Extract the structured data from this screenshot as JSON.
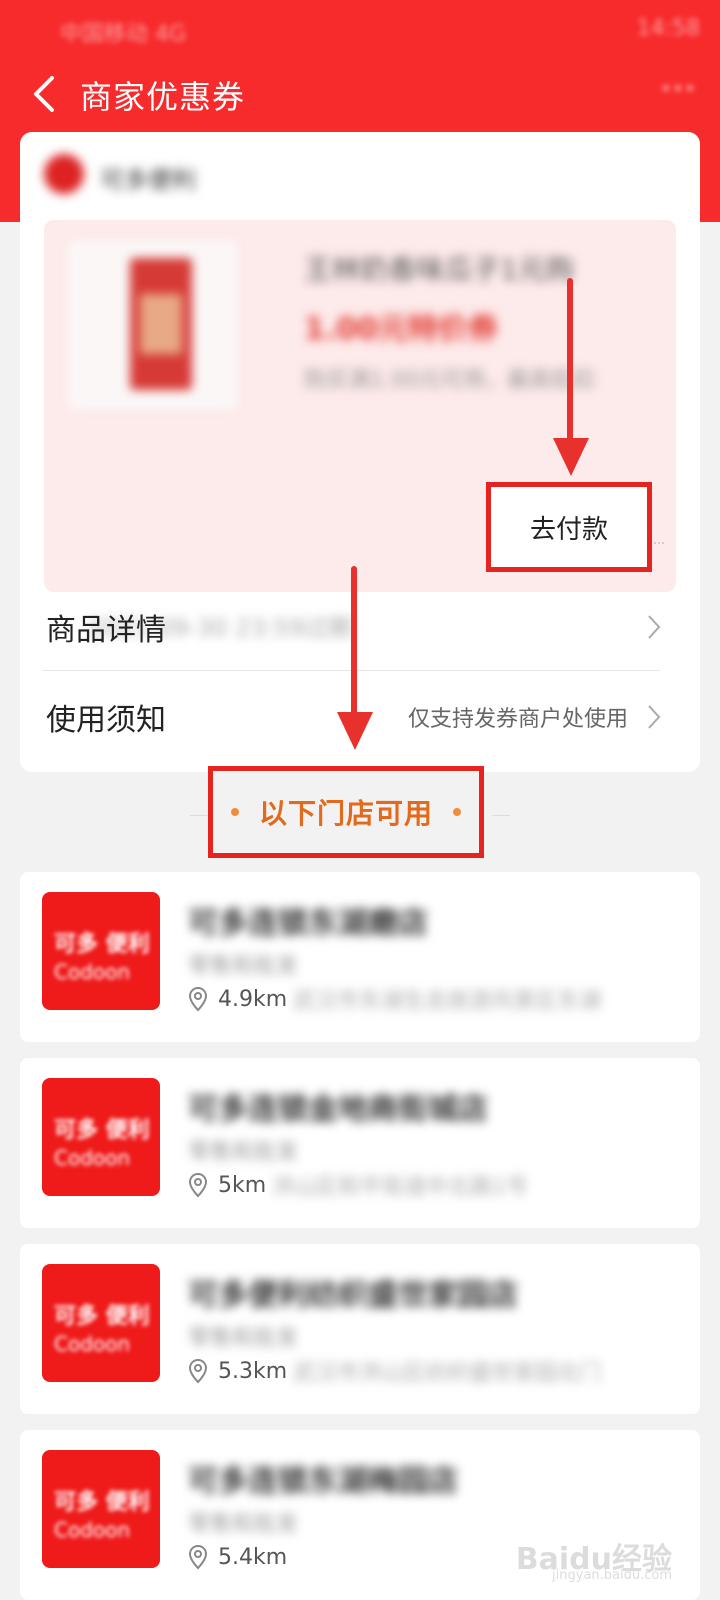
{
  "status_bar": {
    "left_text": "中国移动 4G",
    "right_text": "14:58"
  },
  "header": {
    "title": "商家优惠券"
  },
  "coupon": {
    "merchant_name": "可多便利",
    "product_name": "王林奶香味瓜子1元购",
    "value_text": "1.00元特价券",
    "description": "购买满1.00元可用，最高抵扣",
    "expiry": "2021-09-30 23:59过期",
    "pay_label": "去付款"
  },
  "rows": {
    "product_detail": "商品详情",
    "usage_notes": "使用须知",
    "usage_hint": "仅支持发券商户处使用"
  },
  "stores_heading": "以下门店可用",
  "stores": [
    {
      "name": "可多连锁东湖磨店",
      "category": "零售和批发",
      "distance": "4.9km",
      "address": "武汉市东湖生态旅游风景区东湖"
    },
    {
      "name": "可多连锁金地商街城店",
      "category": "零售和批发",
      "distance": "5km",
      "address": "洪山区和平街道中北路1号"
    },
    {
      "name": "可多便利纺织盛世家园店",
      "category": "零售和批发",
      "distance": "5.3km",
      "address": "武汉市洪山区纺织盛世家园北门"
    },
    {
      "name": "可多连锁东湖梅园店",
      "category": "零售和批发",
      "distance": "5.4km",
      "address": ""
    }
  ],
  "store_logo_text": {
    "line1": "可多 便利",
    "line2": "Codoon"
  },
  "watermark": {
    "brand": "Baidu经验",
    "url": "jingyan.baidu.com"
  },
  "colors": {
    "brand_red": "#f72a2c",
    "accent_orange": "#e36a1c",
    "annotation_red": "#e52420"
  }
}
